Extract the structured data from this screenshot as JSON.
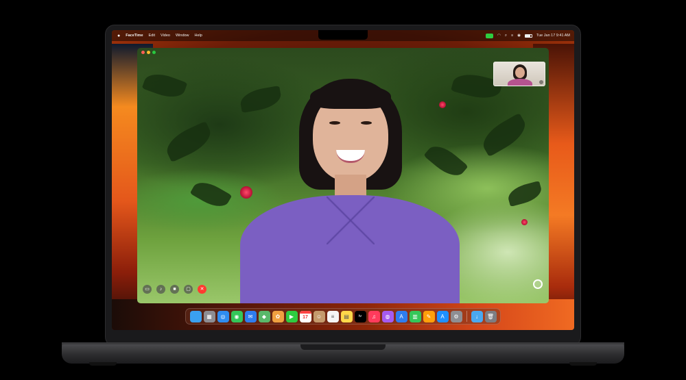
{
  "menubar": {
    "apple": "",
    "app_name": "FaceTime",
    "items": [
      "Edit",
      "Video",
      "Window",
      "Help"
    ],
    "date_time": "Tue Jan 17  9:41 AM"
  },
  "call": {
    "controls": [
      "sidebar",
      "mute",
      "video",
      "screen-share",
      "end-call"
    ]
  },
  "dock": {
    "calendar_day": "17",
    "tv_label": "tv",
    "apps": [
      {
        "name": "finder",
        "color": "#3aa0f0",
        "glyph": ""
      },
      {
        "name": "launchpad",
        "color": "#8d8d93",
        "glyph": "▦"
      },
      {
        "name": "safari",
        "color": "#2f8cf0",
        "glyph": "◎"
      },
      {
        "name": "messages",
        "color": "#34c759",
        "glyph": "◉"
      },
      {
        "name": "mail",
        "color": "#2f7df0",
        "glyph": "✉"
      },
      {
        "name": "maps",
        "color": "#5ab86a",
        "glyph": "◆"
      },
      {
        "name": "photos",
        "color": "#f0a040",
        "glyph": "✿"
      },
      {
        "name": "facetime",
        "color": "#2ecc40",
        "glyph": "▶"
      },
      {
        "name": "calendar",
        "color": "#ffffff",
        "glyph": ""
      },
      {
        "name": "contacts",
        "color": "#c49a6c",
        "glyph": "☺"
      },
      {
        "name": "reminders",
        "color": "#f5f5f5",
        "glyph": "≡"
      },
      {
        "name": "notes",
        "color": "#ffd84a",
        "glyph": "▤"
      },
      {
        "name": "tv",
        "color": "#000000",
        "glyph": ""
      },
      {
        "name": "music",
        "color": "#ff3b5c",
        "glyph": "♫"
      },
      {
        "name": "podcasts",
        "color": "#a55bf0",
        "glyph": "◍"
      },
      {
        "name": "appstore-alt",
        "color": "#2f7df0",
        "glyph": "A"
      },
      {
        "name": "numbers",
        "color": "#34c759",
        "glyph": "▥"
      },
      {
        "name": "pages",
        "color": "#ff9f0a",
        "glyph": "✎"
      },
      {
        "name": "appstore",
        "color": "#1e90ff",
        "glyph": "A"
      },
      {
        "name": "settings",
        "color": "#8e8e93",
        "glyph": "⚙"
      },
      {
        "name": "downloads",
        "color": "#4aa8f0",
        "glyph": "↓"
      },
      {
        "name": "trash",
        "color": "#7d7d82",
        "glyph": "🗑"
      }
    ]
  },
  "colors": {
    "end_call": "#ff3b30",
    "traffic_close": "#ff5f57",
    "traffic_min": "#febc2e",
    "traffic_max": "#28c840"
  }
}
